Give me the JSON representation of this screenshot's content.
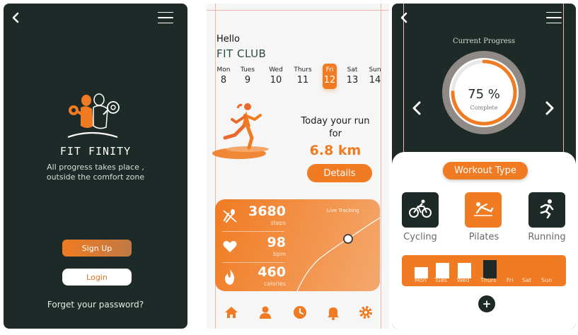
{
  "frame_label": "Gym App",
  "screen1": {
    "brand": "FIT FINITY",
    "tagline": "All progress takes place , outside the comfort zone",
    "signup_label": "Sign Up",
    "login_label": "Login",
    "forgot_label": "Forget your password?"
  },
  "screen2": {
    "hello": "Hello",
    "club": "FIT CLUB",
    "days": [
      {
        "name": "Mon",
        "date": "8"
      },
      {
        "name": "Tues",
        "date": "9"
      },
      {
        "name": "Wed",
        "date": "10"
      },
      {
        "name": "Thurs",
        "date": "11"
      },
      {
        "name": "Fri",
        "date": "12"
      },
      {
        "name": "Sat",
        "date": "13"
      },
      {
        "name": "Sun",
        "date": "14"
      }
    ],
    "active_day": "Fri",
    "today_text": "Today your run for",
    "distance": "6.8 km",
    "details_label": "Details",
    "live_tracking": "Live Tracking",
    "stats": [
      {
        "value": "3680",
        "unit": "steps",
        "icon": "footprints-icon"
      },
      {
        "value": "98",
        "unit": "bpm",
        "icon": "heart-icon"
      },
      {
        "value": "460",
        "unit": "calories",
        "icon": "flame-icon"
      }
    ],
    "tabs": [
      "home-icon",
      "profile-icon",
      "clock-icon",
      "bell-icon",
      "gear-icon"
    ],
    "accent": "#f07b22"
  },
  "screen3": {
    "current_progress": "Current Progress",
    "percent": "75 %",
    "complete": "Complete",
    "progress_value": 0.75,
    "workout_type_label": "Workout Type",
    "workouts": [
      {
        "label": "Cycling",
        "icon": "cycling-icon",
        "selected": false
      },
      {
        "label": "Pilates",
        "icon": "pilates-icon",
        "selected": true
      },
      {
        "label": "Running",
        "icon": "running-icon",
        "selected": false
      }
    ],
    "week_days": [
      "Mon",
      "Tues",
      "Wed",
      "Thurs",
      "Fri",
      "Sat",
      "Sun"
    ],
    "dark": "#1e2a27"
  }
}
